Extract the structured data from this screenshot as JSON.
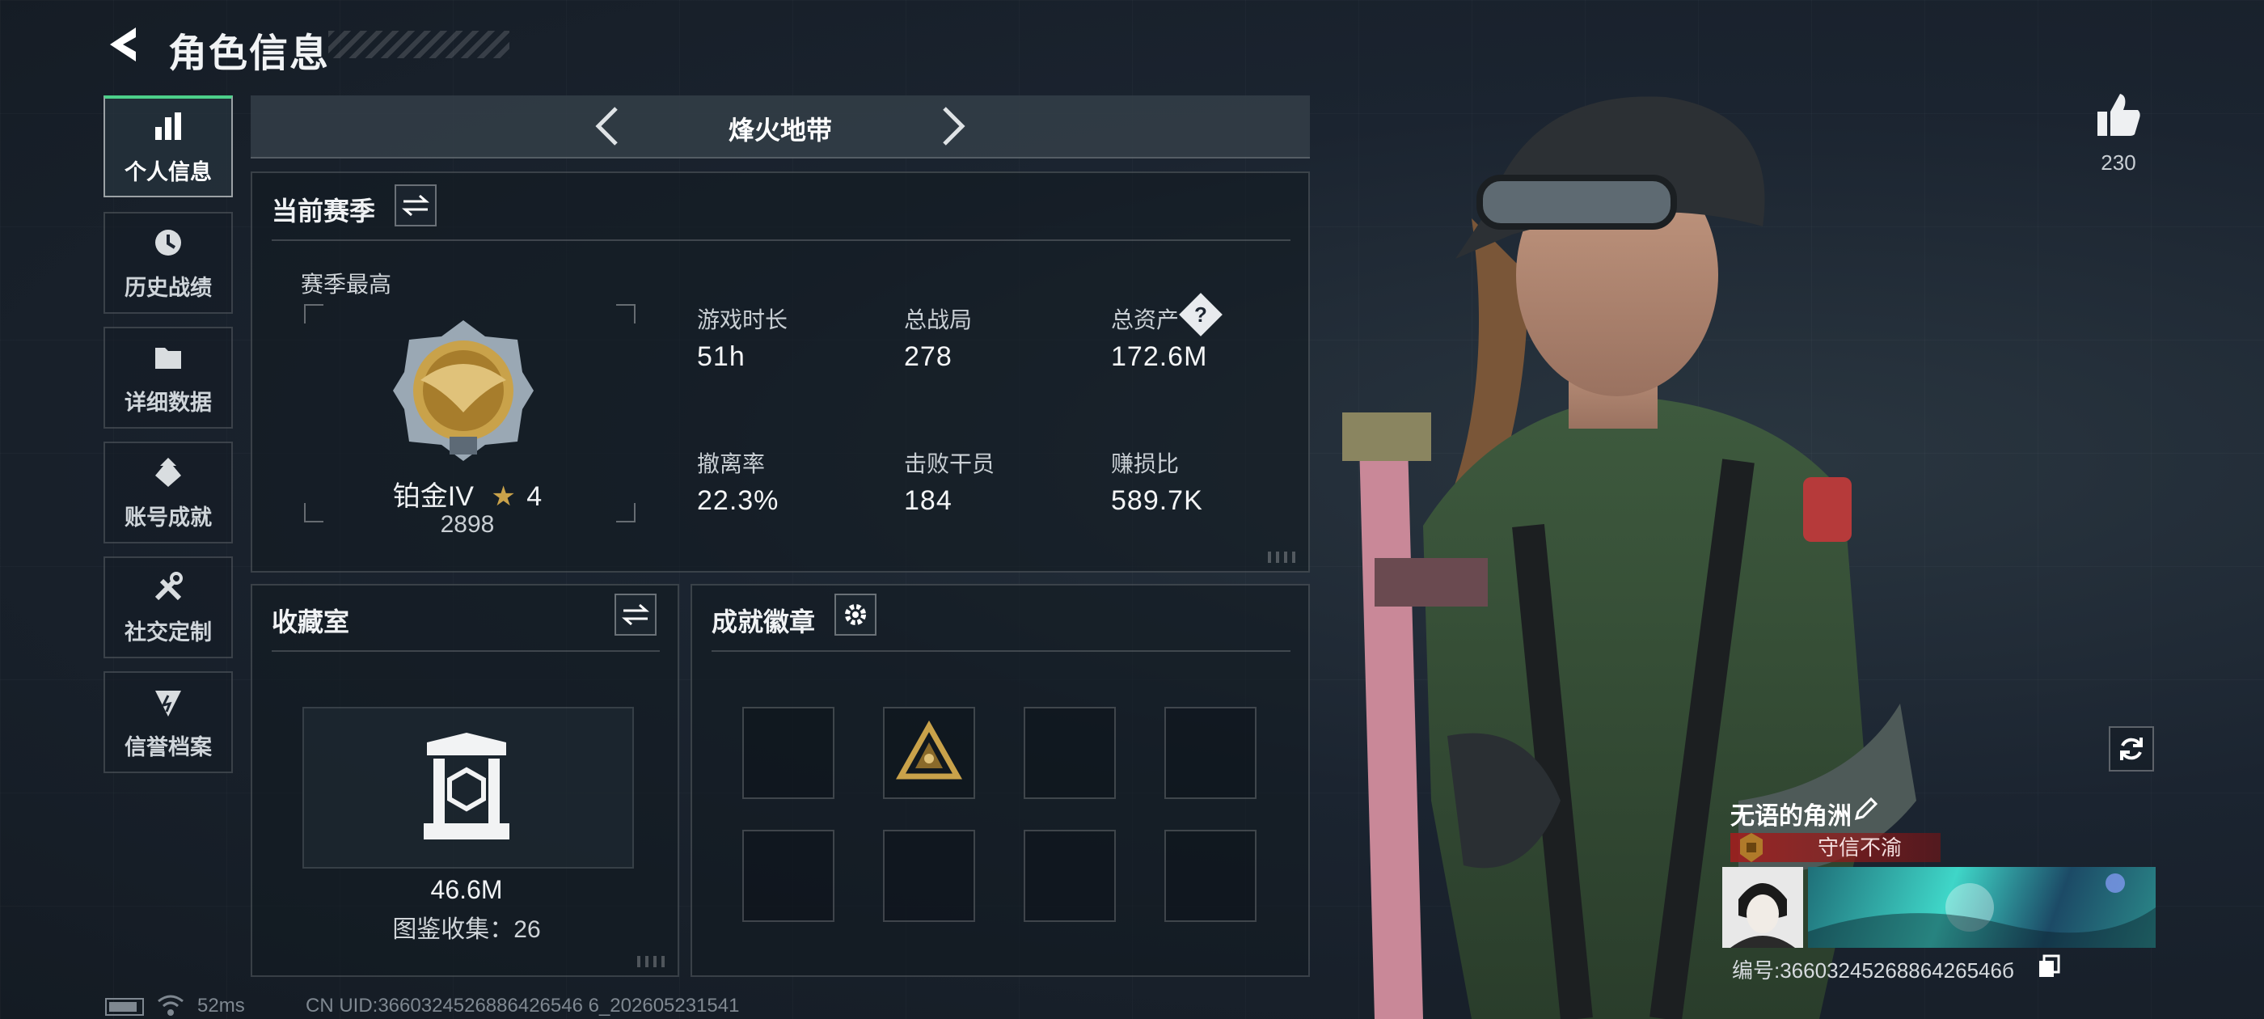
{
  "header": {
    "title": "角色信息"
  },
  "nav": [
    {
      "label": "个人信息",
      "icon": "bar-chart-icon",
      "active": true
    },
    {
      "label": "历史战绩",
      "icon": "clock-icon",
      "active": false
    },
    {
      "label": "详细数据",
      "icon": "folder-icon",
      "active": false
    },
    {
      "label": "账号成就",
      "icon": "achievement-icon",
      "active": false
    },
    {
      "label": "社交定制",
      "icon": "tools-icon",
      "active": false
    },
    {
      "label": "信誉档案",
      "icon": "shield-icon",
      "active": false
    }
  ],
  "mode": {
    "title": "烽火地带"
  },
  "season": {
    "heading": "当前赛季",
    "best_label": "赛季最高",
    "rank_name": "铂金IV",
    "rank_stars": "4",
    "rank_points": "2898",
    "stats": [
      {
        "label": "游戏时长",
        "value": "51h"
      },
      {
        "label": "总战局",
        "value": "278"
      },
      {
        "label": "总资产",
        "value": "172.6M"
      },
      {
        "label": "撤离率",
        "value": "22.3%"
      },
      {
        "label": "击败干员",
        "value": "184"
      },
      {
        "label": "赚损比",
        "value": "589.7K"
      }
    ],
    "help_mark": "?"
  },
  "collection": {
    "heading": "收藏室",
    "value": "46.6M",
    "catalog": "图鉴收集：26"
  },
  "achievements": {
    "heading": "成就徽章"
  },
  "social": {
    "like_count": "230",
    "player_name": "无语的角洲",
    "player_title": "守信不渝",
    "player_id": "编号:3660324526886426546б"
  },
  "footer": {
    "ping": "52ms",
    "uid": "CN UID:3660324526886426546 6_202605231541"
  },
  "colors": {
    "accent": "#4cd08a",
    "panel_border": "#3a4550",
    "banner": "#a01e1e",
    "gold": "#c9a24a"
  }
}
